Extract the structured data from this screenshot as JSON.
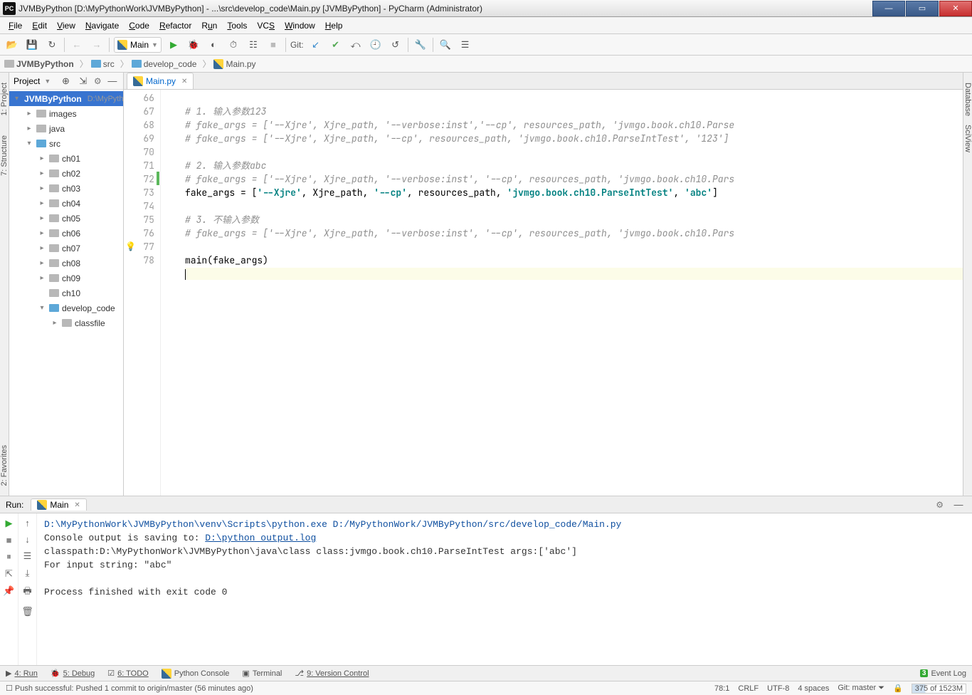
{
  "titlebar": {
    "app_icon": "PC",
    "title": "JVMByPython [D:\\MyPythonWork\\JVMByPython] - ...\\src\\develop_code\\Main.py [JVMByPython] - PyCharm (Administrator)"
  },
  "menu": {
    "file": "File",
    "edit": "Edit",
    "view": "View",
    "navigate": "Navigate",
    "code": "Code",
    "refactor": "Refactor",
    "run": "Run",
    "tools": "Tools",
    "vcs": "VCS",
    "window": "Window",
    "help": "Help"
  },
  "toolbar": {
    "run_config": "Main",
    "git_label": "Git:"
  },
  "breadcrumb": {
    "root": "JVMByPython",
    "src": "src",
    "dev": "develop_code",
    "file": "Main.py"
  },
  "left_tabs": {
    "project": "1: Project",
    "structure": "7: Structure",
    "favorites": "2: Favorites"
  },
  "right_tabs": {
    "database": "Database",
    "sciview": "SciView"
  },
  "project_panel": {
    "title": "Project",
    "root": "JVMByPython",
    "root_path": "D:\\MyPythonWork\\JVMByPython",
    "images": "images",
    "java": "java",
    "src": "src",
    "ch01": "ch01",
    "ch02": "ch02",
    "ch03": "ch03",
    "ch04": "ch04",
    "ch05": "ch05",
    "ch06": "ch06",
    "ch07": "ch07",
    "ch08": "ch08",
    "ch09": "ch09",
    "ch10": "ch10",
    "develop_code": "develop_code",
    "classfile": "classfile"
  },
  "editor": {
    "tab": "Main.py",
    "lines": {
      "l66": "# 1. 输入参数123",
      "l67": "# fake_args = ['--Xjre', Xjre_path, '--verbose:inst','--cp', resources_path, 'jvmgo.book.ch10.Parse",
      "l68": "# fake_args = ['--Xjre', Xjre_path, '--cp', resources_path, 'jvmgo.book.ch10.ParseIntTest', '123']",
      "l70": "# 2. 输入参数abc",
      "l71": "# fake_args = ['--Xjre', Xjre_path, '--verbose:inst', '--cp', resources_path, 'jvmgo.book.ch10.Pars",
      "l72_pre": "fake_args = [",
      "l72_s1": "'--Xjre'",
      "l72_c1": ", Xjre_path, ",
      "l72_s2": "'--cp'",
      "l72_c2": ", resources_path, ",
      "l72_s3": "'jvmgo.book.ch10.ParseIntTest'",
      "l72_c3": ", ",
      "l72_s4": "'abc'",
      "l72_suf": "]",
      "l74": "# 3. 不输入参数",
      "l75": "# fake_args = ['--Xjre', Xjre_path, '--verbose:inst', '--cp', resources_path, 'jvmgo.book.ch10.Pars",
      "l77": "main(fake_args)"
    },
    "line_numbers": [
      "66",
      "67",
      "68",
      "69",
      "70",
      "71",
      "72",
      "73",
      "74",
      "75",
      "76",
      "77",
      "78"
    ]
  },
  "run": {
    "label": "Run:",
    "tab": "Main",
    "line1": "D:\\MyPythonWork\\JVMByPython\\venv\\Scripts\\python.exe D:/MyPythonWork/JVMByPython/src/develop_code/Main.py",
    "line2a": "Console output is saving to: ",
    "line2b": "D:\\python output.log",
    "line3": "classpath:D:\\MyPythonWork\\JVMByPython\\java\\class class:jvmgo.book.ch10.ParseIntTest args:['abc']",
    "line4": "For input string: \"abc\"",
    "line5": "Process finished with exit code 0"
  },
  "bottom": {
    "run": "4: Run",
    "debug": "5: Debug",
    "todo": "6: TODO",
    "pyconsole": "Python Console",
    "terminal": "Terminal",
    "vcs": "9: Version Control",
    "eventlog": "Event Log",
    "eventlog_count": "3"
  },
  "status": {
    "msg": "Push successful: Pushed 1 commit to origin/master (56 minutes ago)",
    "pos": "78:1",
    "crlf": "CRLF",
    "enc": "UTF-8",
    "indent": "4 spaces",
    "git": "Git: master",
    "mem": "375 of 1523M"
  }
}
